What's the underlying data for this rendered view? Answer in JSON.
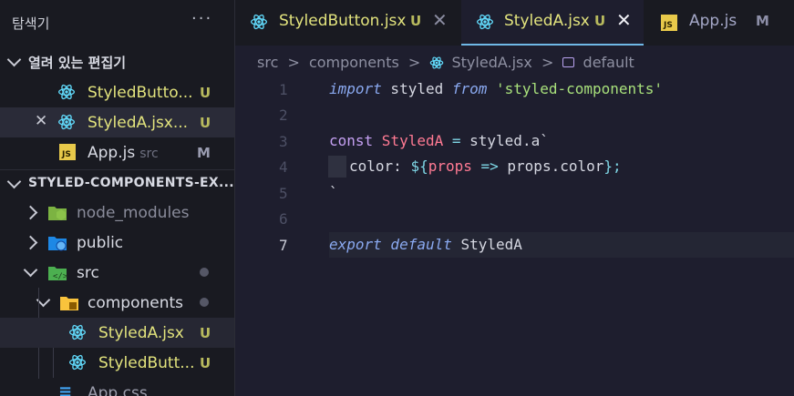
{
  "sidebar": {
    "title": "탐색기",
    "more": "···",
    "open_editors": {
      "label": "열려 있는 편집기",
      "items": [
        {
          "name": "StyledButto...",
          "sub": "",
          "badge": "U",
          "icon": "react-icon"
        },
        {
          "name": "StyledA.jsx...",
          "sub": "",
          "badge": "U",
          "icon": "react-icon",
          "close": "✕"
        },
        {
          "name": "App.js",
          "sub": "src",
          "badge": "M",
          "icon": "js-icon"
        }
      ]
    },
    "project": {
      "label": "STYLED-COMPONENTS-EX...",
      "items": [
        {
          "name": "node_modules",
          "icon": "node-folder-icon"
        },
        {
          "name": "public",
          "icon": "public-folder-icon"
        },
        {
          "name": "src",
          "icon": "src-folder-icon"
        },
        {
          "name": "components",
          "icon": "components-folder-icon"
        },
        {
          "name": "StyledA.jsx",
          "badge": "U",
          "icon": "react-icon"
        },
        {
          "name": "StyledButt...",
          "badge": "U",
          "icon": "react-icon"
        },
        {
          "name": "App.css",
          "icon": "css-icon"
        }
      ]
    }
  },
  "tabs": [
    {
      "label": "StyledButton.jsx",
      "badge": "U",
      "close": "✕"
    },
    {
      "label": "StyledA.jsx",
      "badge": "U",
      "close": "✕"
    },
    {
      "label": "App.js",
      "badge": "M"
    }
  ],
  "breadcrumb": {
    "items": [
      "src",
      "components",
      "StyledA.jsx",
      "default"
    ],
    "sep": ">"
  },
  "editor": {
    "line_numbers": [
      "1",
      "2",
      "3",
      "4",
      "5",
      "6",
      "7"
    ],
    "code": {
      "l1": {
        "import": "import",
        "styled": " styled ",
        "from": "from",
        "str": " 'styled-components'"
      },
      "l3": {
        "const": "const",
        "name": " StyledA",
        "eq": " = ",
        "styled": "styled.a`"
      },
      "l4": {
        "color": "color: ",
        "open": "${",
        "props": "props",
        "arrow": " => ",
        "expr": "props.color",
        "close": "};"
      },
      "l5": "`",
      "l7": {
        "export": "export",
        "default": " default",
        "name": " StyledA"
      }
    }
  },
  "colors": {
    "background": "#1e1e2e",
    "sidebar": "#191a21",
    "untracked": "#e2e37d",
    "accent": "#6fb8e6",
    "react": "#61dafb"
  }
}
